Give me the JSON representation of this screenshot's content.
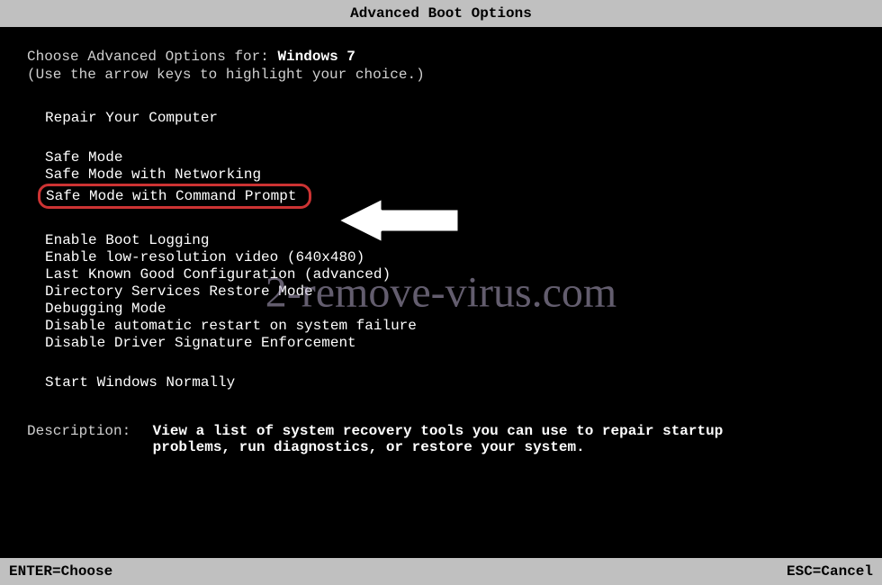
{
  "title": "Advanced Boot Options",
  "prompt": {
    "choose_label": "Choose Advanced Options for:",
    "os_name": "Windows 7",
    "hint": "(Use the arrow keys to highlight your choice.)"
  },
  "menu": {
    "group1": [
      "Repair Your Computer"
    ],
    "group2": [
      "Safe Mode",
      "Safe Mode with Networking",
      "Safe Mode with Command Prompt"
    ],
    "group3": [
      "Enable Boot Logging",
      "Enable low-resolution video (640x480)",
      "Last Known Good Configuration (advanced)",
      "Directory Services Restore Mode",
      "Debugging Mode",
      "Disable automatic restart on system failure",
      "Disable Driver Signature Enforcement"
    ],
    "group4": [
      "Start Windows Normally"
    ]
  },
  "description": {
    "label": "Description:",
    "text": "View a list of system recovery tools you can use to repair startup problems, run diagnostics, or restore your system."
  },
  "footer": {
    "left": "ENTER=Choose",
    "right": "ESC=Cancel"
  },
  "watermark": "2-remove-virus.com"
}
